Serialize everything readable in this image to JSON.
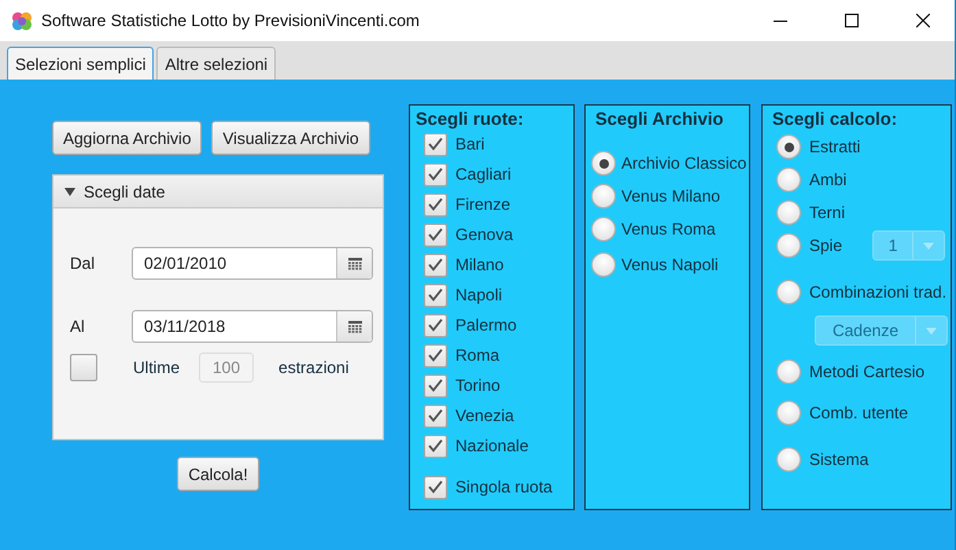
{
  "window": {
    "title": "Software Statistiche Lotto by PrevisioniVincenti.com"
  },
  "tabs": [
    {
      "label": "Selezioni semplici",
      "selected": true
    },
    {
      "label": "Altre selezioni",
      "selected": false
    }
  ],
  "actions": [
    "Aggiorna Archivio",
    "Visualizza Archivio"
  ],
  "dates_panel": {
    "title": "Scegli date",
    "expanded": true,
    "from": {
      "label": "Dal",
      "value": "02/01/2010"
    },
    "to": {
      "label": "Al",
      "value": "03/11/2018"
    },
    "last": {
      "checked": false,
      "label": "Ultime",
      "value": "100",
      "disabled": true,
      "suffix": "estrazioni"
    }
  },
  "calculate_button": "Calcola!",
  "wheels": {
    "title": "Scegli ruote:",
    "items": [
      {
        "label": "Bari",
        "checked": true
      },
      {
        "label": "Cagliari",
        "checked": true
      },
      {
        "label": "Firenze",
        "checked": true
      },
      {
        "label": "Genova",
        "checked": true
      },
      {
        "label": "Milano",
        "checked": true
      },
      {
        "label": "Napoli",
        "checked": true
      },
      {
        "label": "Palermo",
        "checked": true
      },
      {
        "label": "Roma",
        "checked": true
      },
      {
        "label": "Torino",
        "checked": true
      },
      {
        "label": "Venezia",
        "checked": true
      },
      {
        "label": "Nazionale",
        "checked": true
      }
    ],
    "single": {
      "label": "Singola ruota",
      "checked": true
    }
  },
  "archive": {
    "title": "Scegli Archivio",
    "options": [
      {
        "label": "Archivio Classico",
        "selected": true
      },
      {
        "label": "Venus Milano",
        "selected": false
      },
      {
        "label": "Venus Roma",
        "selected": false
      },
      {
        "label": "Venus Napoli",
        "selected": false
      }
    ]
  },
  "calculation": {
    "title": "Scegli calcolo:",
    "options": [
      {
        "kind": "radio",
        "label": "Estratti",
        "selected": true
      },
      {
        "kind": "radio",
        "label": "Ambi",
        "selected": false
      },
      {
        "kind": "radio",
        "label": "Terni",
        "selected": false
      },
      {
        "kind": "radio_combo_inline",
        "label": "Spie",
        "selected": false,
        "combo": {
          "value": "1",
          "disabled": true
        }
      },
      {
        "kind": "radio_combo_below",
        "label": "Combinazioni trad.",
        "selected": false,
        "combo": {
          "value": "Cadenze",
          "disabled": true
        }
      },
      {
        "kind": "radio",
        "label": "Metodi Cartesio",
        "selected": false
      },
      {
        "kind": "radio",
        "label": "Comb. utente",
        "selected": false
      },
      {
        "kind": "radio",
        "label": "Sistema",
        "selected": false
      }
    ]
  }
}
